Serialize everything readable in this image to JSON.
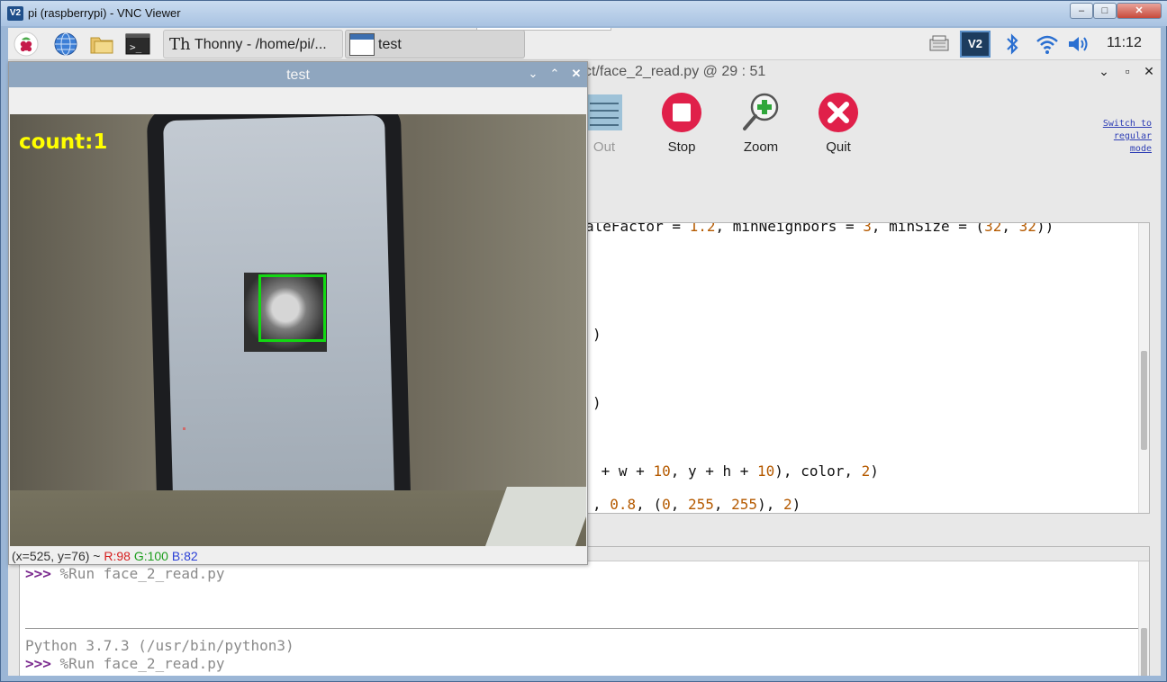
{
  "vnc": {
    "logo": "V2",
    "title": "pi (raspberrypi) - VNC Viewer",
    "min": "–",
    "max": "□",
    "close": "✕"
  },
  "panel": {
    "tasks": [
      {
        "label": "Thonny  -  /home/pi/...",
        "icon": "thonny-icon"
      },
      {
        "label": "test",
        "icon": "window-icon"
      }
    ],
    "tray": {
      "vnc_label": "V2",
      "clock": "11:12"
    }
  },
  "thonny": {
    "title": "ct/face_2_read.py  @  29 : 51",
    "buttons": {
      "min": "⌄",
      "max": "▫",
      "close": "✕"
    },
    "toolbar": {
      "out": "Out",
      "stop": "Stop",
      "zoom": "Zoom",
      "quit": "Quit"
    },
    "mode_link": [
      "Switch to",
      "regular",
      "mode"
    ],
    "editor": {
      "line1_a": "aleFactor = ",
      "line1_n1": "1.2",
      "line1_b": ", minNeighbors = ",
      "line1_n2": "3",
      "line1_c": ", minSize = (",
      "line1_n3": "32",
      "line1_d": ", ",
      "line1_n4": "32",
      "line1_e": "))",
      "line2": ")",
      "line3": ")",
      "line4_a": " + w + ",
      "line4_n1": "10",
      "line4_b": ", y + h + ",
      "line4_n2": "10",
      "line4_c": "), color, ",
      "line4_n3": "2",
      "line4_d": ")",
      "line5_a": ", ",
      "line5_n1": "0.8",
      "line5_b": ", (",
      "line5_n2": "0",
      "line5_c": ", ",
      "line5_n3": "255",
      "line5_d": ", ",
      "line5_n4": "255",
      "line5_e": "), ",
      "line5_n5": "2",
      "line5_f": ")"
    },
    "shell": {
      "prompt": ">>>",
      "cmd1": " %Run face_2_read.py",
      "banner": "Python 3.7.3 (/usr/bin/python3)",
      "cmd2": " %Run face_2_read.py"
    }
  },
  "cv": {
    "title": "test",
    "min": "⌄",
    "max": "⌃",
    "close": "✕",
    "count": "count:1",
    "status": {
      "coords": "(x=525, y=76) ~ ",
      "r": "R:98",
      "g": "G:100",
      "b": "B:82"
    }
  },
  "colors": {
    "face_box": "#12d812",
    "count_text": "#ffff00",
    "stop_red": "#e0204a",
    "quit_red": "#e0204a",
    "zoom_green": "#2fa63a"
  }
}
